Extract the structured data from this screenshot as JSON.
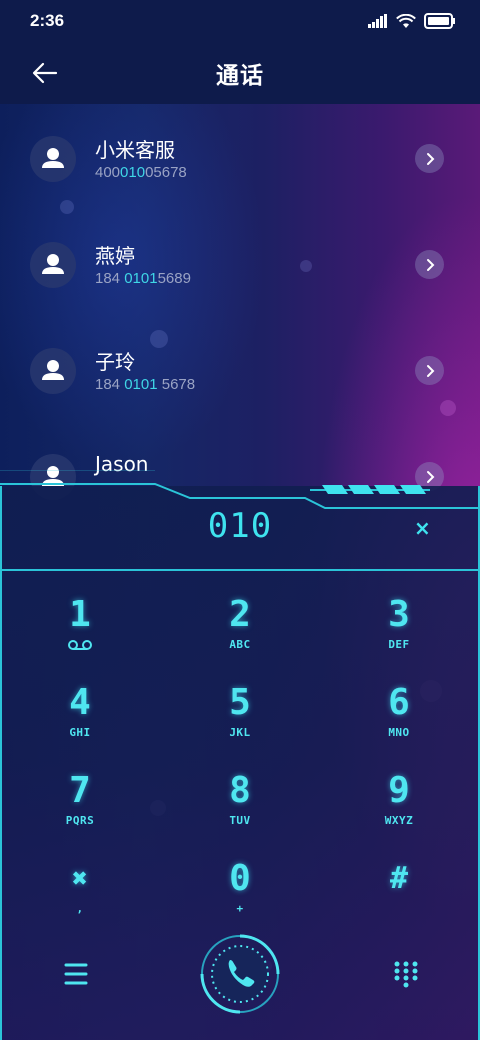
{
  "status_bar": {
    "time": "2:36"
  },
  "header": {
    "title": "通话"
  },
  "contacts": [
    {
      "name": "小米客服",
      "number_parts": [
        "400",
        "010",
        "05678"
      ]
    },
    {
      "name": "燕婷",
      "number_parts": [
        "184 ",
        "0101",
        "5689"
      ]
    },
    {
      "name": "子玲",
      "number_parts": [
        "184 ",
        "0101",
        " 5678"
      ]
    },
    {
      "name": "Jason",
      "number_parts": [
        "",
        "",
        ""
      ]
    }
  ],
  "dialer": {
    "input": "010",
    "clear": "×",
    "keys": [
      {
        "digit": "1",
        "letters": ""
      },
      {
        "digit": "2",
        "letters": "ABC"
      },
      {
        "digit": "3",
        "letters": "DEF"
      },
      {
        "digit": "4",
        "letters": "GHI"
      },
      {
        "digit": "5",
        "letters": "JKL"
      },
      {
        "digit": "6",
        "letters": "MNO"
      },
      {
        "digit": "7",
        "letters": "PQRS"
      },
      {
        "digit": "8",
        "letters": "TUV"
      },
      {
        "digit": "9",
        "letters": "WXYZ"
      },
      {
        "digit": "✖",
        "letters": ","
      },
      {
        "digit": "0",
        "letters": "+"
      },
      {
        "digit": "#",
        "letters": ""
      }
    ]
  },
  "colors": {
    "accent": "#3fe3ee",
    "frame": "#2bc4d8",
    "background": "#0e1b4b"
  }
}
